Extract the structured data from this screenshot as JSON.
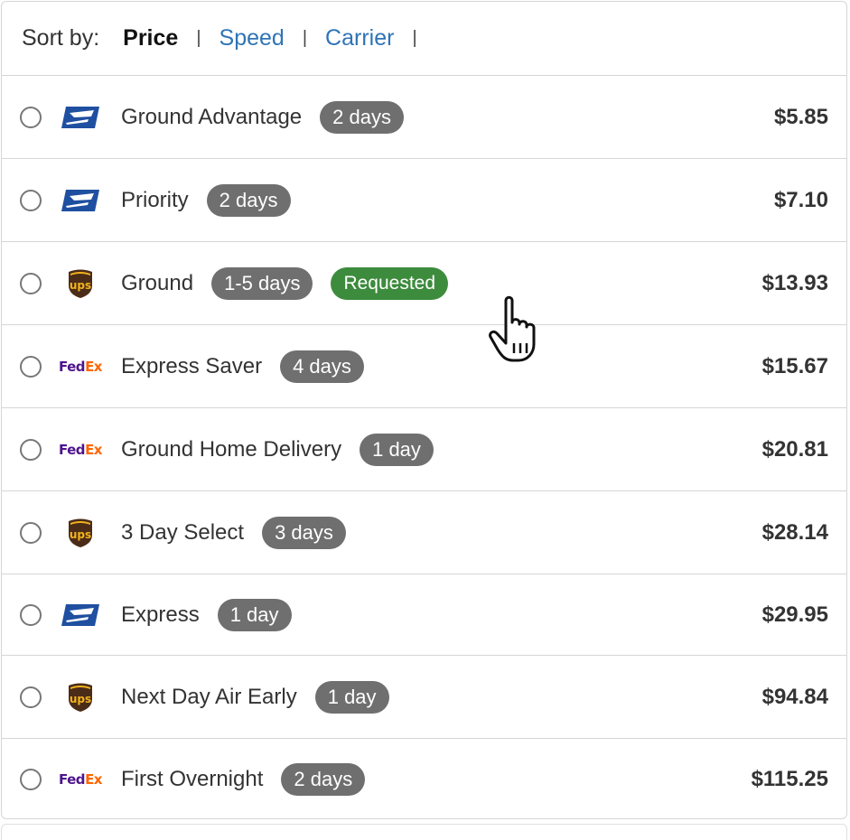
{
  "sort": {
    "label": "Sort by:",
    "options": [
      {
        "label": "Price",
        "active": true
      },
      {
        "label": "Speed",
        "active": false
      },
      {
        "label": "Carrier",
        "active": false
      }
    ],
    "separator": "|"
  },
  "rates": [
    {
      "carrier": "usps-icon",
      "service": "Ground Advantage",
      "transit": "2 days",
      "tag": "",
      "price": "$5.85"
    },
    {
      "carrier": "usps-icon",
      "service": "Priority",
      "transit": "2 days",
      "tag": "",
      "price": "$7.10"
    },
    {
      "carrier": "ups-icon",
      "service": "Ground",
      "transit": "1-5 days",
      "tag": "Requested",
      "price": "$13.93"
    },
    {
      "carrier": "fedex-icon",
      "service": "Express Saver",
      "transit": "4 days",
      "tag": "",
      "price": "$15.67"
    },
    {
      "carrier": "fedex-icon",
      "service": "Ground Home Delivery",
      "transit": "1 day",
      "tag": "",
      "price": "$20.81"
    },
    {
      "carrier": "ups-icon",
      "service": "3 Day Select",
      "transit": "3 days",
      "tag": "",
      "price": "$28.14"
    },
    {
      "carrier": "usps-icon",
      "service": "Express",
      "transit": "1 day",
      "tag": "",
      "price": "$29.95"
    },
    {
      "carrier": "ups-icon",
      "service": "Next Day Air Early",
      "transit": "1 day",
      "tag": "",
      "price": "$94.84"
    },
    {
      "carrier": "fedex-icon",
      "service": "First Overnight",
      "transit": "2 days",
      "tag": "",
      "price": "$115.25"
    }
  ],
  "logos": {
    "fedex_left": "Fed",
    "fedex_right": "Ex",
    "ups": "ups"
  },
  "colors": {
    "link": "#2f74b5",
    "badge": "#6f6f6f",
    "requested": "#3d8b3d",
    "usps": "#1f4fa0",
    "ups_brown": "#4a2c18",
    "ups_gold": "#f2b21d",
    "fedex_purple": "#4d148c",
    "fedex_orange": "#ff6600"
  }
}
